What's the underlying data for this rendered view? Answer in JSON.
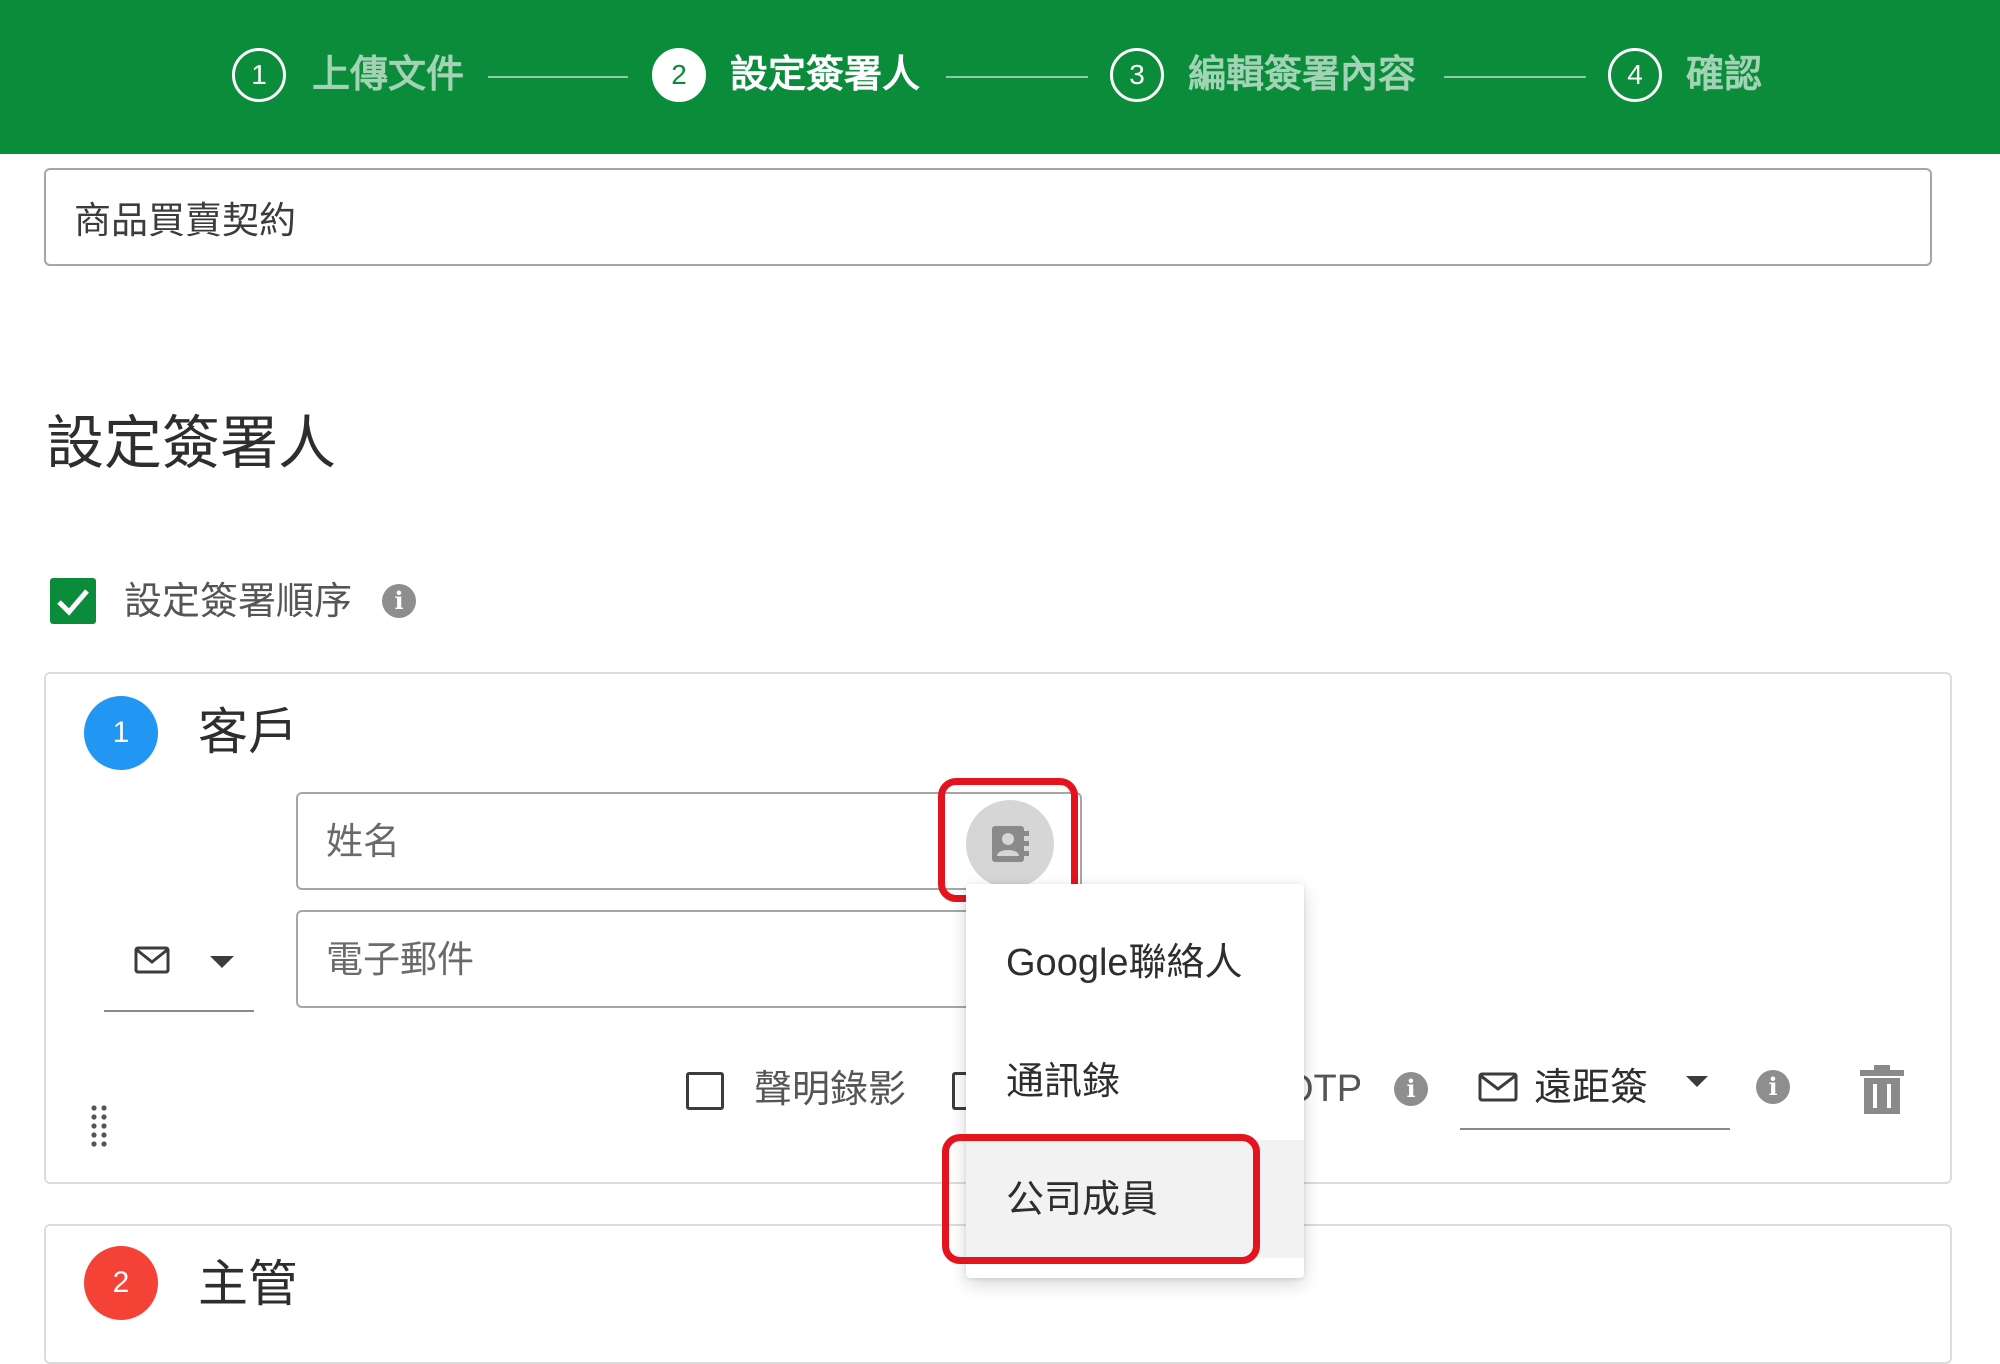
{
  "stepper": {
    "steps": [
      {
        "number": "1",
        "label": "上傳文件"
      },
      {
        "number": "2",
        "label": "設定簽署人"
      },
      {
        "number": "3",
        "label": "編輯簽署內容"
      },
      {
        "number": "4",
        "label": "確認"
      }
    ],
    "active_index": 1
  },
  "document": {
    "name_value": "商品買賣契約"
  },
  "section": {
    "title": "設定簽署人",
    "order_checkbox_label": "設定簽署順序",
    "order_checked": true
  },
  "signers": [
    {
      "number": "1",
      "role": "客戶",
      "badge_color": "#2196f3",
      "name_placeholder": "姓名",
      "email_placeholder": "電子郵件",
      "video_label": "聲明錄影",
      "otp_label_visible": "OTP",
      "sign_method": "遠距簽"
    },
    {
      "number": "2",
      "role": "主管",
      "badge_color": "#f44336"
    }
  ],
  "contact_menu": {
    "items": [
      "Google聯絡人",
      "通訊錄",
      "公司成員"
    ],
    "highlighted_index": 2
  },
  "colors": {
    "brand_green": "#0a8c3a",
    "annotation_red": "#e3141e"
  },
  "icons": {
    "contact_button": "contact-book-icon",
    "email_channel": "envelope-icon",
    "delete": "trash-icon",
    "drag": "drag-handle-icon"
  }
}
